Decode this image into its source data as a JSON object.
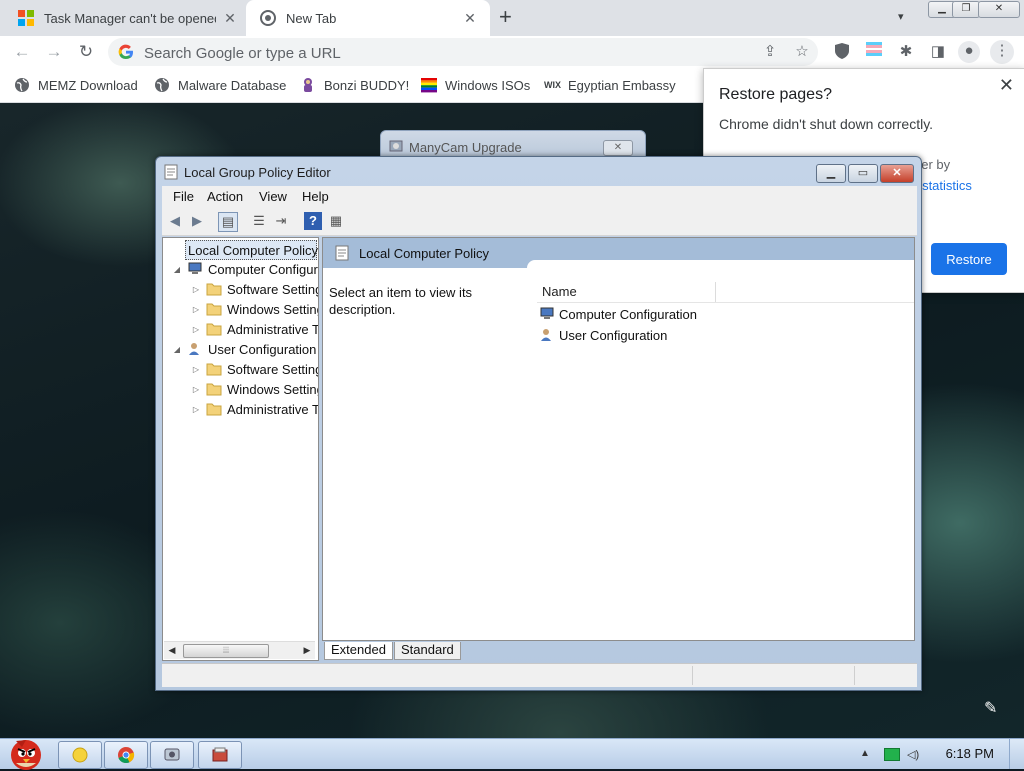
{
  "chrome": {
    "tabs": [
      {
        "title": "Task Manager can't be opened",
        "close": "✕"
      },
      {
        "title": "New Tab",
        "close": "✕"
      }
    ],
    "new_tab_symbol": "+",
    "omnibox_placeholder": "Search Google or type a URL",
    "bookmarks": [
      {
        "label": "MEMZ Download",
        "icon": "globe-icon"
      },
      {
        "label": "Malware Database",
        "icon": "globe-icon"
      },
      {
        "label": "Bonzi BUDDY!",
        "icon": "bonzi-icon"
      },
      {
        "label": "Windows ISOs",
        "icon": "rainbow-flag-icon"
      },
      {
        "label": "Egyptian Embassy",
        "icon": "wix-icon"
      }
    ],
    "bookmark_wix_text": "WIX"
  },
  "restore_popup": {
    "title": "Restore pages?",
    "message": "Chrome didn't shut down correctly.",
    "partial_line1": "tter by",
    "partial_line2": "ge statistics",
    "button": "Restore"
  },
  "manycam": {
    "title": "ManyCam Upgrade"
  },
  "gpedit": {
    "title": "Local Group Policy Editor",
    "menu": [
      "File",
      "Action",
      "View",
      "Help"
    ],
    "tree": {
      "root": "Local Computer Policy",
      "computer_config": "Computer Configuration",
      "computer_children": [
        "Software Settings",
        "Windows Settings",
        "Administrative Templates"
      ],
      "user_config": "User Configuration",
      "user_children": [
        "Software Settings",
        "Windows Settings",
        "Administrative Templates"
      ]
    },
    "header_title": "Local Computer Policy",
    "description": "Select an item to view its description.",
    "list_column": "Name",
    "list_items": [
      "Computer Configuration",
      "User Configuration"
    ],
    "view_tabs": [
      "Extended",
      "Standard"
    ]
  },
  "taskbar": {
    "clock": "6:18 PM"
  },
  "colors": {
    "chrome_blue": "#1a73e8",
    "tabstrip": "#dee1e6",
    "gpe_header": "#a4bcd8"
  }
}
